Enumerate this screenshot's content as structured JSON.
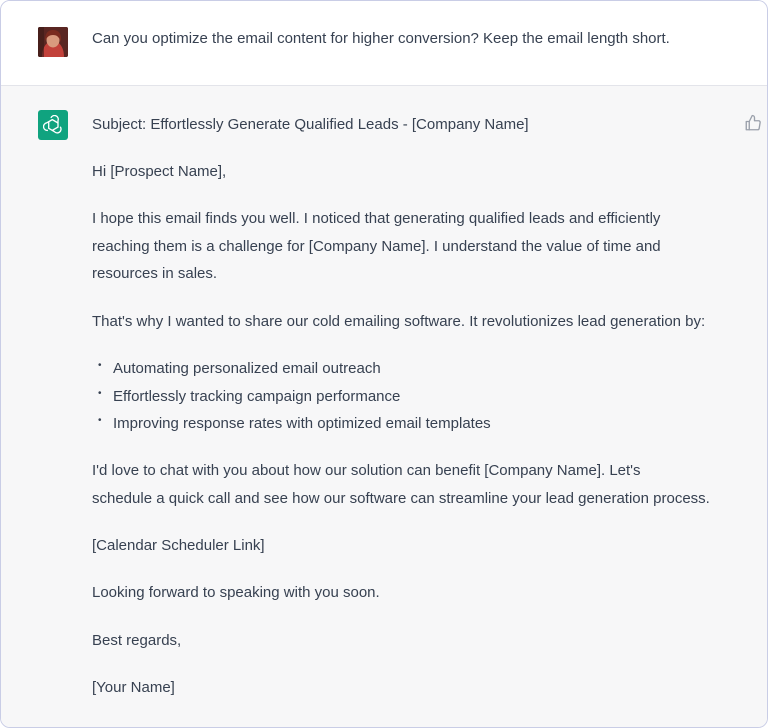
{
  "user": {
    "avatar_icon": "user-photo-avatar",
    "message": "Can you optimize the email content for higher conversion? Keep the email length short."
  },
  "assistant": {
    "avatar_icon": "openai-logo-icon",
    "brand_color": "#10a37f",
    "feedback_icon": "thumbs-up-icon",
    "subject": "Subject: Effortlessly Generate Qualified Leads - [Company Name]",
    "greeting": "Hi [Prospect Name],",
    "para1": [
      "I hope this email finds you well. I noticed that generating qualified leads and efficiently",
      "reaching them is a challenge for [Company Name]. I understand the value of time and",
      "resources in sales."
    ],
    "para2": "That's why I wanted to share our cold emailing software. It revolutionizes lead generation by:",
    "bullets": [
      "Automating personalized email outreach",
      "Effortlessly tracking campaign performance",
      "Improving response rates with optimized email templates"
    ],
    "para3": [
      "I'd love to chat with you about how our solution can benefit [Company Name]. Let's",
      "schedule a quick call and see how our software can streamline your lead generation process."
    ],
    "link_placeholder": "[Calendar Scheduler Link]",
    "closing": "Looking forward to speaking with you soon.",
    "signoff": "Best regards,",
    "name_placeholder": "[Your Name]"
  }
}
